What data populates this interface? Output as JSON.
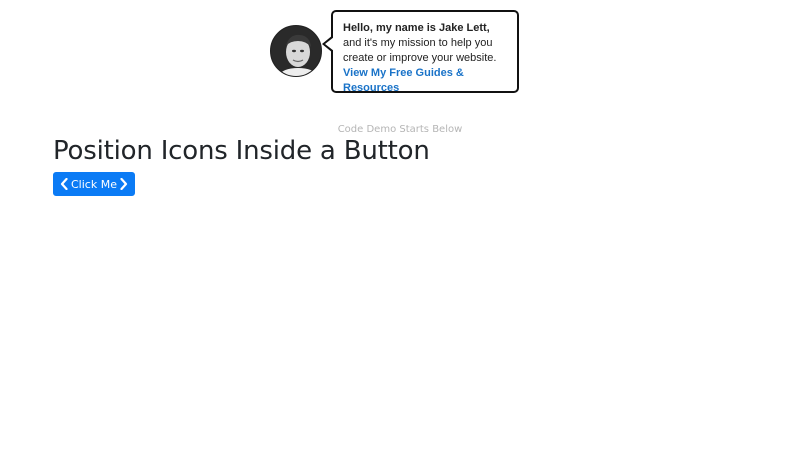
{
  "intro": {
    "greeting": "Hello, my name is Jake Lett,",
    "body_text": " and it's my mission to help you create or improve your website. ",
    "link_text": "View My Free Guides & Resources"
  },
  "demo_label": "Code Demo Starts Below",
  "page_title": "Position Icons Inside a Button",
  "button": {
    "label": "Click Me",
    "left_icon": "chevron-left-icon",
    "right_icon": "chevron-right-icon"
  },
  "colors": {
    "button_bg": "#0b7bf5",
    "link": "#1a73c8"
  }
}
